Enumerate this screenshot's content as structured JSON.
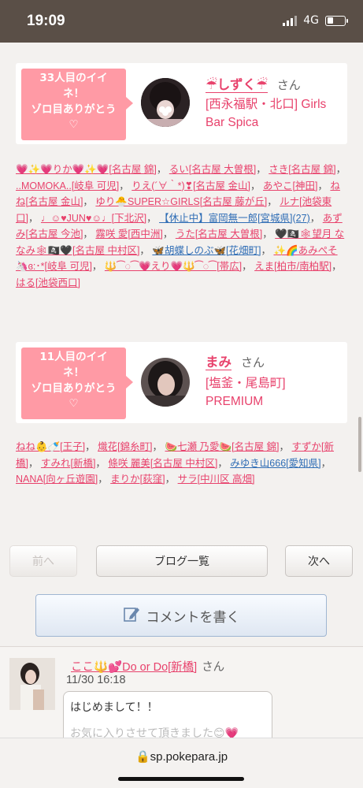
{
  "status": {
    "time": "19:09",
    "network": "4G",
    "battery_level": 0.35
  },
  "cards": [
    {
      "bubble_lines": [
        "33人目のイイ",
        "ネ！",
        "ゾロ目ありがとう",
        "♡"
      ],
      "name": "☔しずく☔",
      "san": "さん",
      "shop": "[西永福駅・北口] Girls Bar Spica"
    },
    {
      "bubble_lines": [
        "11人目のイイ",
        "ネ！",
        "ゾロ目ありがとう",
        "♡"
      ],
      "name": "まみ",
      "san": "さん",
      "shop": "[塩釜・尾島町] PREMIUM"
    }
  ],
  "likers1": [
    "💗✨💗りか💗✨💗[名古屋 錦]",
    "るい[名古屋 大曽根]",
    "さき[名古屋 錦]",
    "..MOMOKA..[岐阜 可児]",
    "りえ(´∀｀*)❣[名古屋 金山]",
    "あやこ[神田]",
    "ねね[名古屋 金山]",
    "ゆり🐣SUPER☆GIRLS[名古屋 藤が丘]",
    "ルナ[池袋東口]",
    "♩☺♥JUN♥☺♩[下北沢]",
    "【休止中】富岡無一郎[宮城県](27)",
    "あずみ[名古屋 今池]",
    "霧咲 愛[西中洲]",
    "うた[名古屋 大曽根]",
    "🖤🏴‍☠️🕸望月 ななみ🕸🏴‍☠️🖤[名古屋 中村区]",
    "🦋胡蝶しのぶ🦋[花畑町]",
    "✨🌈あみぺそ🦄ɞ:･*[岐阜 可児]",
    "🔱⁀◌⁀💗えり💗🔱⁀◌⁀[帯広]",
    "えま[柏市/南柏駅]",
    "はる[池袋西口]"
  ],
  "likers2": [
    "ねね👶🍼[王子]",
    "熾花[錦糸町]",
    "🍉七瀬 乃愛🍉[名古屋 錦]",
    "すずか[新橋]",
    "すみれ[新橋]",
    "條咲 麗美[名古屋 中村区]",
    "みゆき山666[愛知県]",
    "NANA[向ヶ丘遊園]",
    "まりか[荻窪]",
    "サラ[中川区 高畑]"
  ],
  "nav": {
    "prev": "前へ",
    "list": "ブログ一覧",
    "next": "次へ"
  },
  "comment_button": "コメントを書く",
  "comment": {
    "name": "ここ🔱💕Do or Do[新橋]",
    "san": "さん",
    "date": "11/30 16:18",
    "text_line1": "はじめまして！！",
    "text_line2": "お気に入りさせて頂きました😊💗"
  },
  "url": "sp.pokepara.jp"
}
